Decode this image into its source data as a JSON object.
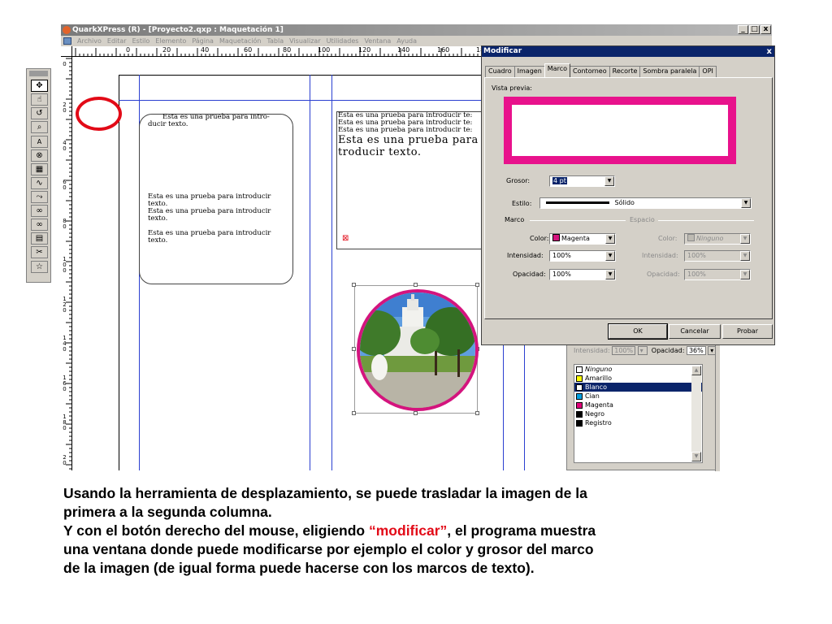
{
  "window": {
    "title": "QuarkXPress (R) - [Proyecto2.qxp : Maquetación 1]",
    "controls": [
      "_",
      "□",
      "x"
    ]
  },
  "menu": [
    "Archivo",
    "Editar",
    "Estilo",
    "Elemento",
    "Página",
    "Maquetación",
    "Tabla",
    "Visualizar",
    "Utilidades",
    "Ventana",
    "Ayuda"
  ],
  "ruler": {
    "h_labels": [
      "0",
      "20",
      "40",
      "60",
      "80",
      "100",
      "120",
      "140",
      "160",
      "180"
    ],
    "v_labels": [
      "0",
      "2 0",
      "4 0",
      "6 0",
      "8 0",
      "1 0 0",
      "1 2 0",
      "1 4 0",
      "1 6 0",
      "1 8 0",
      "2 0"
    ]
  },
  "document": {
    "box1_line1": "Esta es una prueba para intro-",
    "box1_line2": "ducir texto.",
    "box2_p1": "Esta es una prueba para introducir texto.",
    "box2_p2": "Esta es una prueba para introducir texto.",
    "box2_p3": "Esta es una prueba para introducir texto.",
    "box3_l1": "Esta es una prueba para introducir te:",
    "box3_l2": "Esta es una prueba para introducir te:",
    "box3_l3": "Esta es una prueba para introducir te:",
    "box3_big1": "Esta es una prueba para i",
    "box3_big2": "troducir texto.",
    "overflow_marker": "⊠"
  },
  "tools": [
    "✥",
    "☝",
    "↺",
    "⌕",
    "A",
    "⊗",
    "▦",
    "∿",
    "⤳",
    "∞",
    "∞",
    "▤",
    "✂",
    "☆"
  ],
  "colors_palette": {
    "intensity_label": "Intensidad:",
    "intensity_value": "100%",
    "opacity_label": "Opacidad:",
    "opacity_value": "36%",
    "items": [
      {
        "name": "Ninguno",
        "swatch": "none",
        "italic": true
      },
      {
        "name": "Amarillo",
        "swatch": "#ffff00",
        "cmyk": true
      },
      {
        "name": "Blanco",
        "swatch": "#ffffff",
        "selected": true
      },
      {
        "name": "Cian",
        "swatch": "#00a0e0",
        "cmyk": true
      },
      {
        "name": "Magenta",
        "swatch": "#e0007a",
        "cmyk": true
      },
      {
        "name": "Negro",
        "swatch": "#000000",
        "cmyk": true
      },
      {
        "name": "Registro",
        "swatch": "#000000"
      }
    ]
  },
  "dialog": {
    "title": "Modificar",
    "close": "x",
    "tabs": [
      "Cuadro",
      "Imagen",
      "Marco",
      "Contorneo",
      "Recorte",
      "Sombra paralela",
      "OPI"
    ],
    "active_tab": "Marco",
    "preview_label": "Vista previa:",
    "grosor_label": "Grosor:",
    "grosor_value": "4 pt",
    "estilo_label": "Estilo:",
    "estilo_value": "Sólido",
    "marco_group": "Marco",
    "espacio_group": "Espacio",
    "color_label": "Color:",
    "color_value": "Magenta",
    "intensidad_label": "Intensidad:",
    "intensidad_value": "100%",
    "opacidad_label": "Opacidad:",
    "opacidad_value": "100%",
    "gap_color_label": "Color:",
    "gap_color_value": "Ninguno",
    "gap_intensidad_label": "Intensidad:",
    "gap_intensidad_value": "100%",
    "gap_opacidad_label": "Opacidad:",
    "gap_opacidad_value": "100%",
    "ok": "OK",
    "cancel": "Cancelar",
    "try": "Probar",
    "frame_color": "#e8128c"
  },
  "caption": {
    "line1": "Usando la herramienta de desplazamiento, se puede trasladar la imagen de la",
    "line2": "primera a la segunda columna.",
    "line3_a": "Y con el botón derecho del mouse, eligiendo ",
    "line3_hl": "“modificar”",
    "line3_b": ", el programa muestra",
    "line4": "una ventana donde puede modificarse por ejemplo el color y grosor del marco",
    "line5": "de la imagen (de igual forma puede hacerse con los marcos de texto)."
  }
}
